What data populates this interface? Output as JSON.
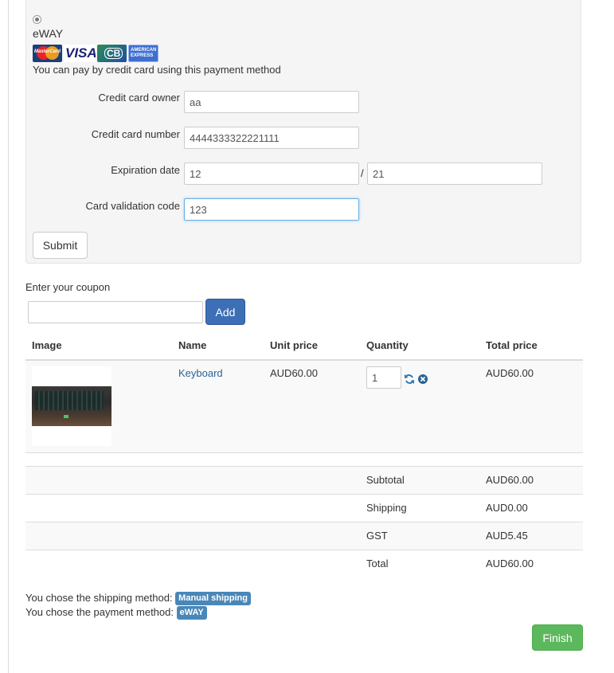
{
  "payment": {
    "method_name": "eWAY",
    "description": "You can pay by credit card using this payment method",
    "card_logos": [
      {
        "name": "mastercard-logo",
        "text": "MasterCard"
      },
      {
        "name": "visa-logo",
        "text": "VISA"
      },
      {
        "name": "cb-logo",
        "text": "CB"
      },
      {
        "name": "amex-logo",
        "text": "AMERICAN EXPRESS"
      }
    ],
    "fields": {
      "owner_label": "Credit card owner",
      "owner_value": "aa",
      "number_label": "Credit card number",
      "number_value": "4444333322221111",
      "expiry_label": "Expiration date",
      "expiry_month": "12",
      "expiry_separator": "/",
      "expiry_year": "21",
      "cvc_label": "Card validation code",
      "cvc_value": "123"
    },
    "submit_label": "Submit"
  },
  "coupon": {
    "label": "Enter your coupon",
    "value": "",
    "add_label": "Add"
  },
  "cart": {
    "headers": [
      "Image",
      "Name",
      "Unit price",
      "Quantity",
      "Total price"
    ],
    "items": [
      {
        "name": "Keyboard",
        "unit_price": "AUD60.00",
        "quantity": "1",
        "total_price": "AUD60.00"
      }
    ],
    "summary": [
      {
        "label": "Subtotal",
        "value": "AUD60.00"
      },
      {
        "label": "Shipping",
        "value": "AUD0.00"
      },
      {
        "label": "GST",
        "value": "AUD5.45"
      },
      {
        "label": "Total",
        "value": "AUD60.00"
      }
    ]
  },
  "choices": {
    "shipping_text": "You chose the shipping method:",
    "shipping_method": "Manual shipping",
    "payment_text": "You chose the payment method:",
    "payment_method": "eWAY"
  },
  "finish_label": "Finish",
  "colors": {
    "primary": "#3d6fb6",
    "success": "#5cb85c",
    "badge": "#4a87b9",
    "link": "#2a6496"
  }
}
